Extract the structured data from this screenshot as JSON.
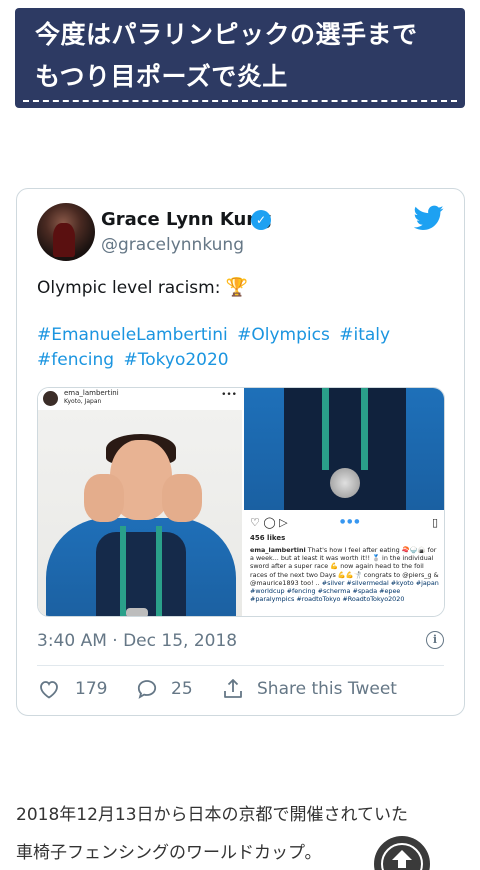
{
  "article": {
    "banner_line1": "今度はパラリンピックの選手まで",
    "banner_line2": "もつり目ポーズで炎上",
    "body_line1": "2018年12月13日から日本の京都で開催されていた",
    "body_line2": "車椅子フェンシングのワールドカップ。"
  },
  "tweet": {
    "display_name": "Grace Lynn Kung",
    "handle": "@gracelynnkung",
    "text": "Olympic level racism:",
    "hashtags": [
      "#EmanueleLambertini",
      "#Olympics",
      "#italy",
      "#fencing",
      "#Tokyo2020"
    ],
    "timestamp": "3:40 AM · Dec 15, 2018",
    "likes": "179",
    "replies": "25",
    "share_label": "Share this Tweet",
    "colors": {
      "accent": "#1da1f2",
      "link": "#1b95e0",
      "muted": "#657786"
    }
  },
  "instagram": {
    "username": "ema_lambertini",
    "location": "Kyoto, Japan",
    "likes": "456 likes",
    "caption_user": "ema_lambertini",
    "caption_text": "That's how I feel after eating 🍣🍚🍙 for a week... but at least it was worth it!! 🥈 in the individual sword after a super race 💪 now again head to the foil races of the next two Days 💪💪🤺 congrats to @piers_g & @maurice1893 too! ..",
    "caption_tags": "#silver #silvermedal #kyoto #japan #worldcup #fencing #scherma #spada #epee #paralympics #roadtoTokyo #RoadtoTokyo2020"
  }
}
